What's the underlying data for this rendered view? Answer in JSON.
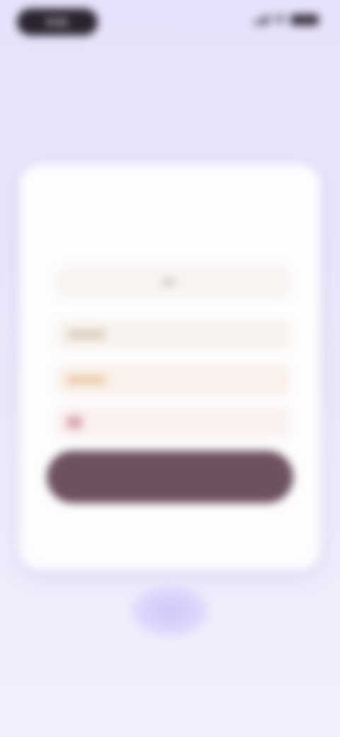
{
  "status_bar": {
    "time": "9:41"
  },
  "dialog": {
    "title": "",
    "options": [
      {
        "label": ""
      },
      {
        "label": ""
      },
      {
        "label": ""
      },
      {
        "label": ""
      }
    ],
    "primary_button_label": "",
    "secondary_link_label": ""
  },
  "colors": {
    "background": "#e8e4fb",
    "card": "#fdfcfe",
    "primary_button": "#6d515e",
    "orb": "#cfc8fa"
  }
}
